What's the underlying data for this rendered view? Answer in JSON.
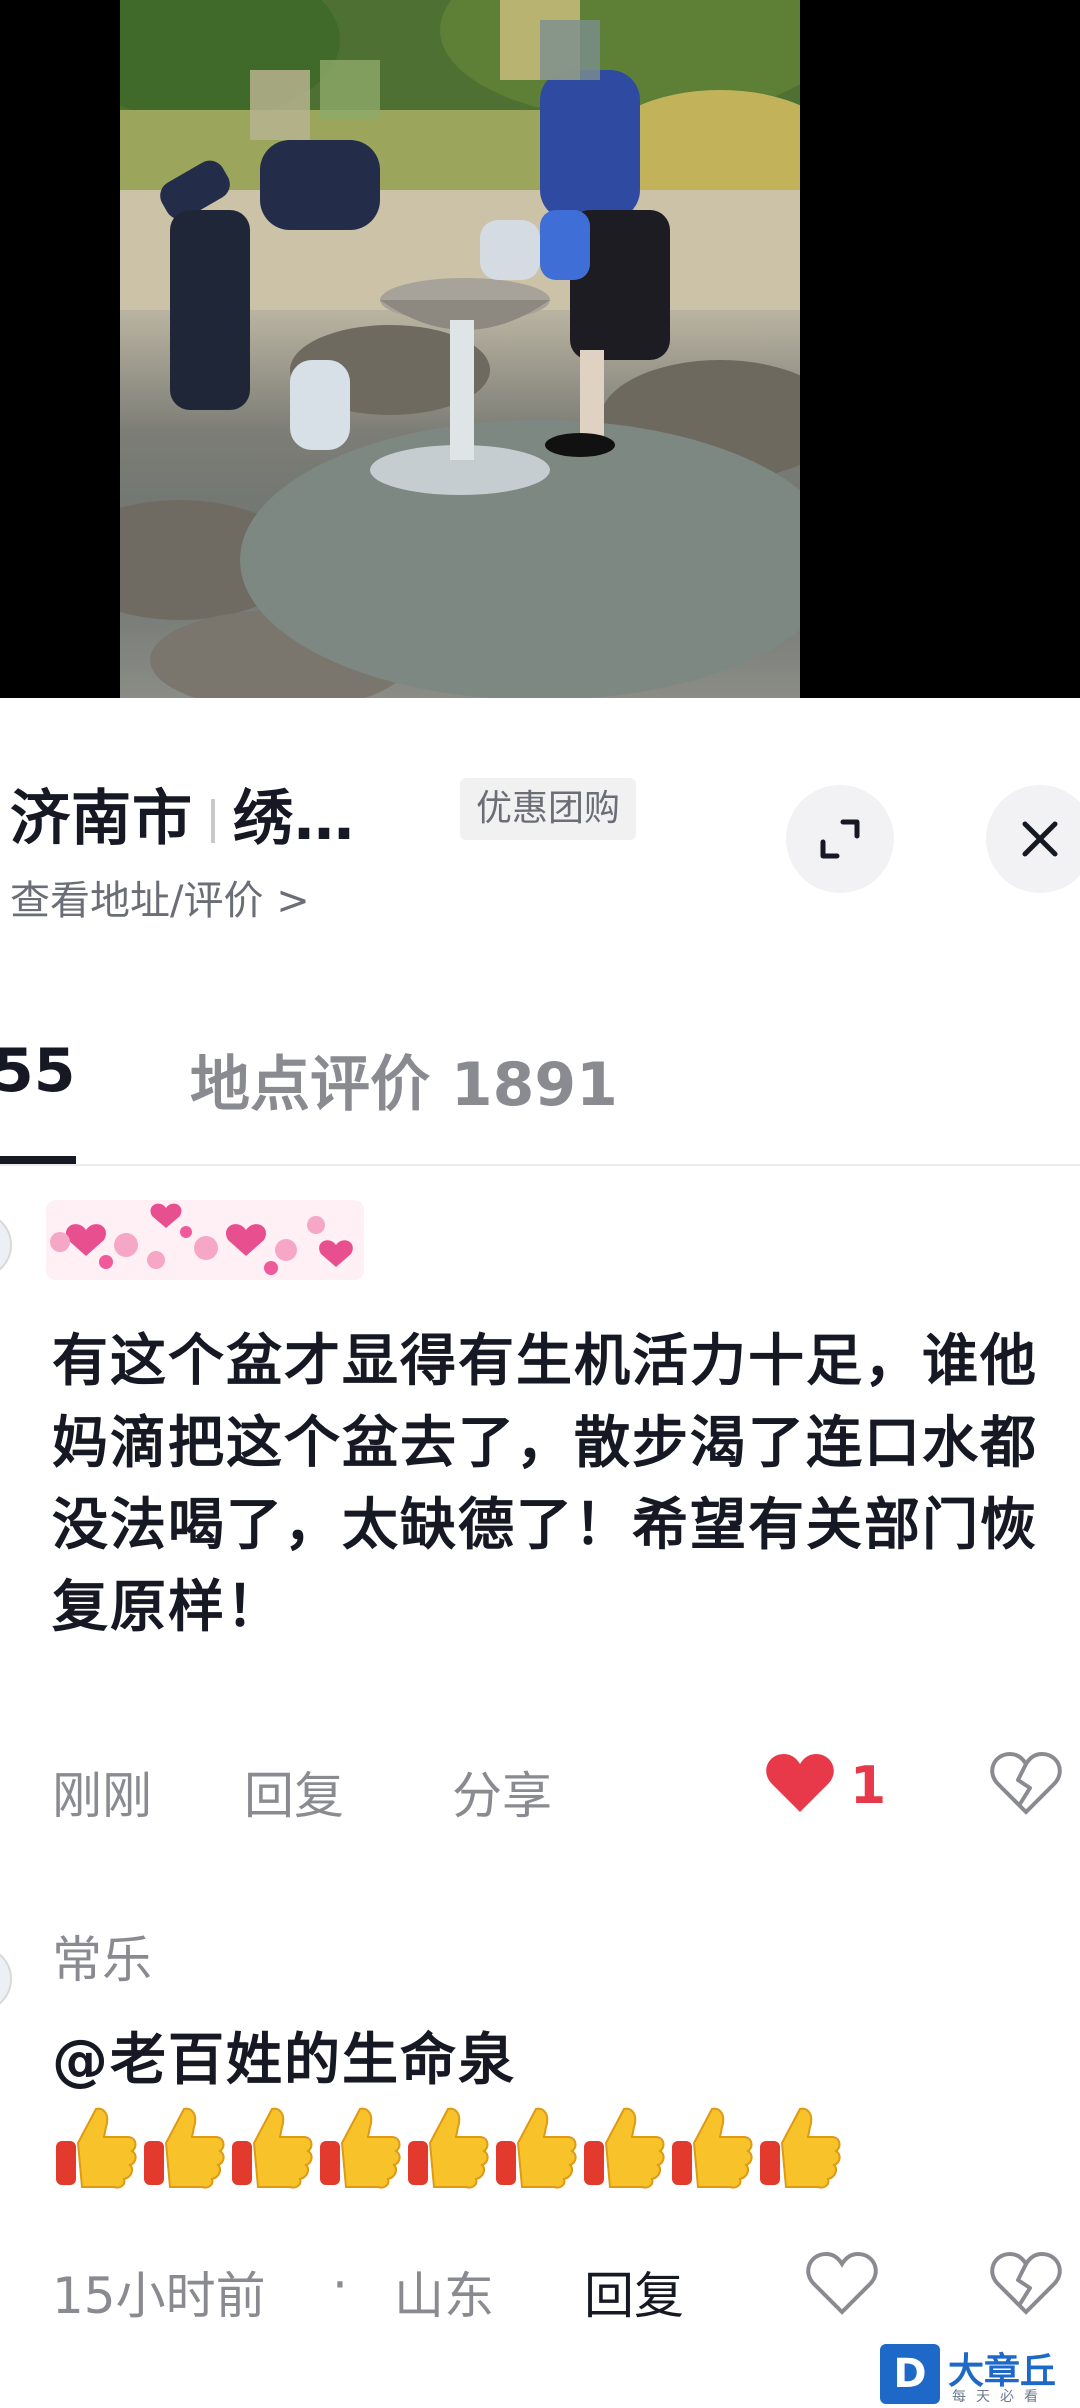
{
  "video": {
    "image_description": "Photo: two people filling water jugs at a spring basin beside rocks"
  },
  "poi": {
    "name": "济南市",
    "name_suffix": "绣…",
    "deal_tag": "优惠团购",
    "subtitle": "查看地址/评价 >"
  },
  "tabs": {
    "videos_count": "55",
    "reviews_label": "地点评价 1891"
  },
  "comments": [
    {
      "author": "",
      "text": "有这个盆才显得有生机活力十足，谁他妈滴把这个盆去了，散步渴了连口水都没法喝了，太缺德了！希望有关部门恢复原样！",
      "time": "刚刚",
      "reply_label": "回复",
      "share_label": "分享",
      "likes": "1"
    },
    {
      "author": "常乐",
      "text": "@老百姓的生命泉",
      "thumbs_count": 9,
      "time": "15小时前",
      "dot": "·",
      "location": "山东",
      "reply_label": "回复"
    }
  ],
  "watermark": {
    "name": "大章丘",
    "sub": "每天必看",
    "logo": "D"
  },
  "colors": {
    "like_red": "#e8394b",
    "text_dark": "#161823",
    "text_gray": "#8a8b91",
    "brand_blue": "#1e68c7"
  }
}
